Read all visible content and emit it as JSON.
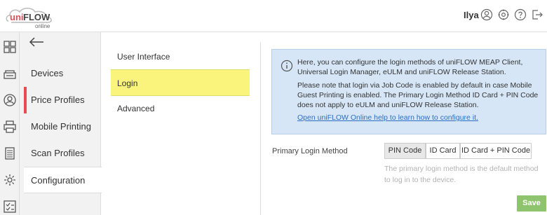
{
  "brand": {
    "logo_text": "uniFLOW",
    "logo_sub": "online",
    "accent": "#e74c55"
  },
  "header": {
    "user_name": "Ilya",
    "icons": [
      "user-icon",
      "help-icon",
      "logout-icon"
    ]
  },
  "rail": {
    "icons": [
      "dashboard-icon",
      "devices-icon",
      "price-profiles-icon",
      "printer-icon",
      "scan-icon",
      "settings-icon",
      "tasks-icon"
    ]
  },
  "nav": {
    "items": [
      {
        "label": "Devices"
      },
      {
        "label": "Price Profiles"
      },
      {
        "label": "Mobile Printing"
      },
      {
        "label": "Scan Profiles"
      },
      {
        "label": "Configuration"
      }
    ],
    "active_label": "Configuration"
  },
  "subnav": {
    "items": [
      {
        "label": "User Interface"
      },
      {
        "label": "Login"
      },
      {
        "label": "Advanced"
      }
    ],
    "selected_label": "Login",
    "selected_color": "#faf47c"
  },
  "info": {
    "para1": "Here, you can configure the login methods of uniFLOW MEAP Client, Universal Login Manager, eULM and uniFLOW Release Station.",
    "para2": "Please note that login via Job Code is enabled by default in case Mobile Guest Printing is enabled. The Primary Login Method ID Card + PIN Code does not apply to eULM and uniFLOW Release Station.",
    "link": "Open uniFLOW Online help to learn how to configure it."
  },
  "login_method": {
    "label": "Primary Login Method",
    "options": [
      "PIN Code",
      "ID Card",
      "ID Card + PIN Code"
    ],
    "selected": "PIN Code",
    "help": "The primary login method is the default method to log in to the device."
  },
  "actions": {
    "save_label": "Save",
    "save_color": "#8fc46e"
  }
}
